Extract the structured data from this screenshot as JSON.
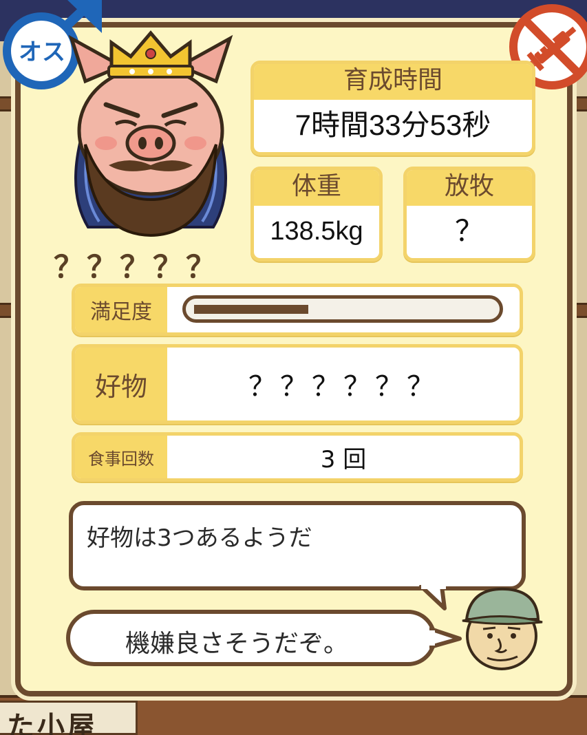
{
  "gender": {
    "label": "オス"
  },
  "pig": {
    "name": "？？？？？"
  },
  "stats": {
    "growth_time": {
      "label": "育成時間",
      "value": "7時間33分53秒"
    },
    "weight": {
      "label": "体重",
      "value": "138.5kg"
    },
    "grazing": {
      "label": "放牧",
      "value": "？"
    }
  },
  "satisfaction": {
    "label": "満足度",
    "level": 0.38
  },
  "favorite": {
    "label": "好物",
    "value": "？？？？？？"
  },
  "meals": {
    "label": "食事回数",
    "value": "3 回"
  },
  "hint_message": "好物は3つあるようだ",
  "farmer_message": "機嫌良さそうだぞ。",
  "colors": {
    "panel_bg": "#fdf6c4",
    "panel_border": "#6b4a2e",
    "label_bg": "#f7d868",
    "gender_blue": "#1f66b8",
    "inject_red": "#d24c2a"
  },
  "icons": [
    "male-symbol-icon",
    "no-injection-icon",
    "pig-king-portrait",
    "farmer-icon"
  ]
}
